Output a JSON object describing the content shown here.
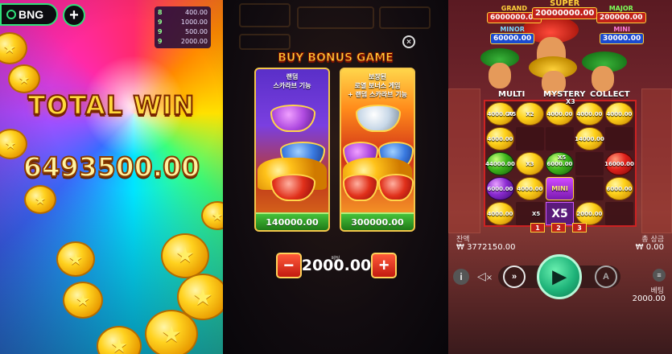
{
  "panel1": {
    "brand": "BNG",
    "plus": "+",
    "paytable": [
      {
        "n": "8",
        "v": "400.00"
      },
      {
        "n": "9",
        "v": "1000.00"
      },
      {
        "n": "9",
        "v": "500.00"
      },
      {
        "n": "9",
        "v": "2000.00"
      }
    ],
    "total_win_label": "TOTAL WIN",
    "total_win_amount": "6493500.00"
  },
  "panel2": {
    "close": "×",
    "title": "BUY BONUS GAME",
    "cards": [
      {
        "desc_line1": "랜덤",
        "desc_line2": "스카라브 기능",
        "desc_line3": "",
        "price": "140000.00"
      },
      {
        "desc_line1": "보장된",
        "desc_line2": "로열 보너스 게임",
        "desc_line3": "+ 랜덤 스카라브 기능",
        "price": "300000.00"
      }
    ],
    "bet_label": "베팅",
    "bet_value": "2000.00",
    "minus": "−",
    "plus": "+"
  },
  "panel3": {
    "jackpots": {
      "grand": {
        "label": "GRAND",
        "value": "6000000.00"
      },
      "super": {
        "label": "SUPER",
        "value": "20000000.00"
      },
      "major": {
        "label": "MAJOR",
        "value": "200000.00"
      },
      "minor": {
        "label": "MINOR",
        "value": "60000.00"
      },
      "mini": {
        "label": "MINI",
        "value": "30000.00"
      }
    },
    "features": {
      "multi": "MULTI",
      "mystery": "MYSTERY",
      "collect": "COLLECT",
      "x2": "X2",
      "x3": "X3"
    },
    "cells": [
      {
        "t": "gold",
        "v": "4000.00"
      },
      {
        "t": "gold",
        "v": "X2"
      },
      {
        "t": "gold",
        "v": "4000.00"
      },
      {
        "t": "gold",
        "v": "4000.00"
      },
      {
        "t": "gold",
        "v": "4000.00"
      },
      {
        "t": "gold",
        "v": "4000.00"
      },
      {
        "t": "empty",
        "v": ""
      },
      {
        "t": "empty",
        "v": ""
      },
      {
        "t": "gold",
        "v": "14000.00"
      },
      {
        "t": "empty",
        "v": ""
      },
      {
        "t": "green",
        "v": "44000.00"
      },
      {
        "t": "gold",
        "v": "X3"
      },
      {
        "t": "green",
        "v": "6000.00"
      },
      {
        "t": "empty",
        "v": ""
      },
      {
        "t": "red",
        "v": "16000.00"
      },
      {
        "t": "purple",
        "v": "6000.00"
      },
      {
        "t": "gold",
        "v": "4000.00"
      },
      {
        "t": "mini",
        "v": "MINI"
      },
      {
        "t": "empty",
        "v": ""
      },
      {
        "t": "gold",
        "v": "6000.00"
      },
      {
        "t": "gold",
        "v": "4000.00"
      },
      {
        "t": "empty",
        "v": ""
      },
      {
        "t": "x5",
        "v": "X5"
      },
      {
        "t": "gold",
        "v": "2000.00"
      },
      {
        "t": "empty",
        "v": ""
      }
    ],
    "small_marks": [
      "X5",
      "X5",
      "X5"
    ],
    "tabs": [
      "1",
      "2",
      "3"
    ],
    "balance_label": "잔액",
    "balance_value": "₩ 3772150.00",
    "win_label": "총 상금",
    "win_value": "₩ 0.00",
    "bet_label": "베팅",
    "bet_value": "2000.00",
    "info_icon": "i",
    "sound_icon": "×",
    "turbo_icon": "»",
    "auto_icon": "A"
  },
  "colors": {
    "accent_green": "#2fe07a",
    "spin_green": "#1fb47a",
    "price_green": "#46c23a",
    "gold": "#ffd23a",
    "jackpot_red": "#c0201a"
  }
}
